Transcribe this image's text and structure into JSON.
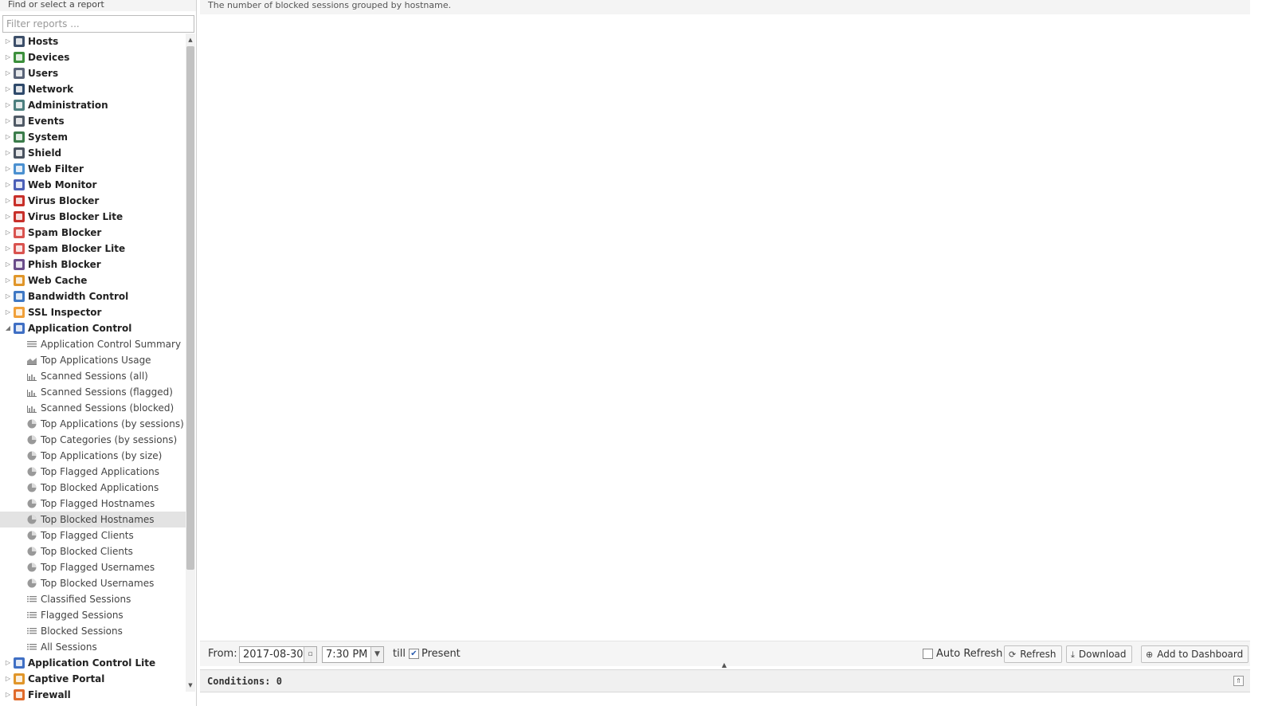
{
  "left_panel": {
    "header": "Find or select a report",
    "filter_placeholder": "Filter reports ..."
  },
  "tree": [
    {
      "label": "Hosts",
      "color": "#3d4f6a",
      "expanded": false
    },
    {
      "label": "Devices",
      "color": "#3b8f3b",
      "expanded": false
    },
    {
      "label": "Users",
      "color": "#5a6478",
      "expanded": false
    },
    {
      "label": "Network",
      "color": "#2f4a6b",
      "expanded": false
    },
    {
      "label": "Administration",
      "color": "#4c7f7f",
      "expanded": false
    },
    {
      "label": "Events",
      "color": "#505a66",
      "expanded": false
    },
    {
      "label": "System",
      "color": "#3a7c4a",
      "expanded": false
    },
    {
      "label": "Shield",
      "color": "#4a5360",
      "expanded": false
    },
    {
      "label": "Web Filter",
      "color": "#4a90d0",
      "expanded": false
    },
    {
      "label": "Web Monitor",
      "color": "#4b5fb8",
      "expanded": false
    },
    {
      "label": "Virus Blocker",
      "color": "#c8302a",
      "expanded": false
    },
    {
      "label": "Virus Blocker Lite",
      "color": "#c8302a",
      "expanded": false
    },
    {
      "label": "Spam Blocker",
      "color": "#d9534f",
      "expanded": false
    },
    {
      "label": "Spam Blocker Lite",
      "color": "#d9534f",
      "expanded": false
    },
    {
      "label": "Phish Blocker",
      "color": "#6a4c8a",
      "expanded": false
    },
    {
      "label": "Web Cache",
      "color": "#e0962a",
      "expanded": false
    },
    {
      "label": "Bandwidth Control",
      "color": "#3f78c4",
      "expanded": false
    },
    {
      "label": "SSL Inspector",
      "color": "#f0a03a",
      "expanded": false
    },
    {
      "label": "Application Control",
      "color": "#3f6fc4",
      "expanded": true,
      "children": [
        {
          "label": "Application Control Summary",
          "icon": "text-report-icon"
        },
        {
          "label": "Top Applications Usage",
          "icon": "area-chart-icon"
        },
        {
          "label": "Scanned Sessions (all)",
          "icon": "bar-chart-icon"
        },
        {
          "label": "Scanned Sessions (flagged)",
          "icon": "bar-chart-icon"
        },
        {
          "label": "Scanned Sessions (blocked)",
          "icon": "bar-chart-icon"
        },
        {
          "label": "Top Applications (by sessions)",
          "icon": "pie-chart-icon"
        },
        {
          "label": "Top Categories (by sessions)",
          "icon": "pie-chart-icon"
        },
        {
          "label": "Top Applications (by size)",
          "icon": "pie-chart-icon"
        },
        {
          "label": "Top Flagged Applications",
          "icon": "pie-chart-icon"
        },
        {
          "label": "Top Blocked Applications",
          "icon": "pie-chart-icon"
        },
        {
          "label": "Top Flagged Hostnames",
          "icon": "pie-chart-icon"
        },
        {
          "label": "Top Blocked Hostnames",
          "icon": "pie-chart-icon",
          "selected": true
        },
        {
          "label": "Top Flagged Clients",
          "icon": "pie-chart-icon"
        },
        {
          "label": "Top Blocked Clients",
          "icon": "pie-chart-icon"
        },
        {
          "label": "Top Flagged Usernames",
          "icon": "pie-chart-icon"
        },
        {
          "label": "Top Blocked Usernames",
          "icon": "pie-chart-icon"
        },
        {
          "label": "Classified Sessions",
          "icon": "list-icon"
        },
        {
          "label": "Flagged Sessions",
          "icon": "list-icon"
        },
        {
          "label": "Blocked Sessions",
          "icon": "list-icon"
        },
        {
          "label": "All Sessions",
          "icon": "list-icon"
        }
      ]
    },
    {
      "label": "Application Control Lite",
      "color": "#3f6fc4",
      "expanded": false
    },
    {
      "label": "Captive Portal",
      "color": "#e0962a",
      "expanded": false
    },
    {
      "label": "Firewall",
      "color": "#e06a2a",
      "expanded": false
    }
  ],
  "main": {
    "description": "The number of blocked sessions grouped by hostname."
  },
  "toolbar": {
    "from_label": "From:",
    "date_value": "2017-08-30",
    "time_value": "7:30 PM",
    "till_label": "till",
    "present_checked": true,
    "present_label": "Present",
    "auto_refresh_checked": false,
    "auto_refresh_label": "Auto Refresh",
    "refresh_label": "Refresh",
    "download_label": "Download",
    "add_dashboard_label": "Add to Dashboard"
  },
  "conditions": {
    "title": "Conditions: 0"
  }
}
